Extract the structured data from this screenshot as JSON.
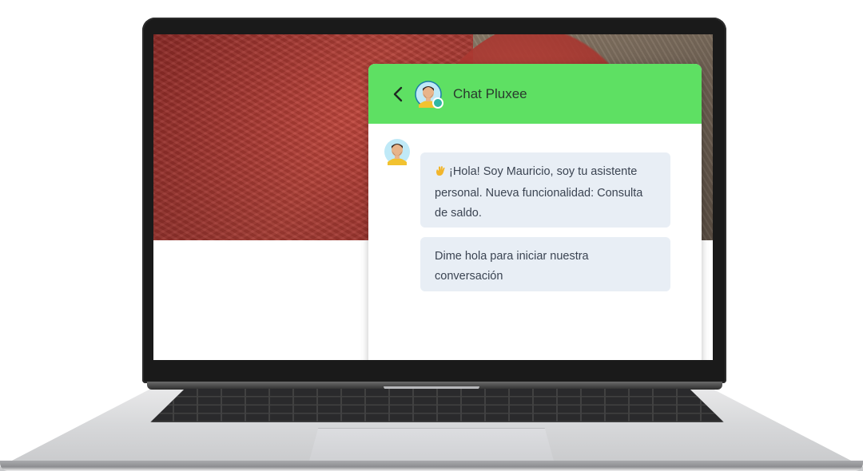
{
  "chat": {
    "title": "Chat Pluxee",
    "status": "online",
    "messages": [
      {
        "sender": "bot",
        "icon": "waving-hand-icon",
        "text": "¡Hola! Soy Mauricio, soy tu asistente personal. Nueva funcionalidad: Consulta de saldo."
      },
      {
        "sender": "bot",
        "text": "Dime hola para iniciar nuestra conversación"
      }
    ]
  },
  "colors": {
    "header": "#5ee063",
    "bubble": "#e8eef5",
    "text": "#3b4452",
    "online": "#2fb7a3"
  },
  "icons": {
    "back": "chevron-left-icon",
    "avatar": "bot-avatar-icon"
  }
}
